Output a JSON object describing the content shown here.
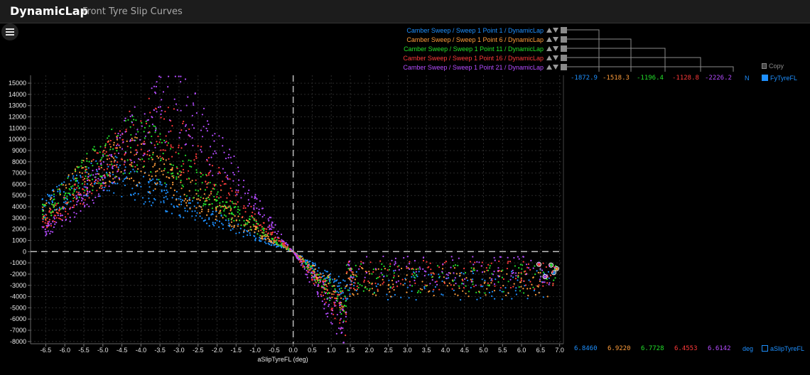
{
  "header": {
    "app": "DynamicLap",
    "page": "Front Tyre Slip Curves"
  },
  "toolbar": {
    "copy_label": "Copy"
  },
  "chart_data": {
    "type": "scatter",
    "xlabel": "aSlipTyreFL (deg)",
    "ylabel": "FyTyreFL",
    "xlim": [
      -6.9,
      7.1
    ],
    "ylim": [
      -8200,
      15700
    ],
    "xticks": [
      "-6.5",
      "-6.0",
      "-5.5",
      "-5.0",
      "-4.5",
      "-4.0",
      "-3.5",
      "-3.0",
      "-2.5",
      "-2.0",
      "-1.5",
      "-1.0",
      "-0.5",
      "0.0",
      "0.5",
      "1.0",
      "1.5",
      "2.0",
      "2.5",
      "3.0",
      "3.5",
      "4.0",
      "4.5",
      "5.0",
      "5.5",
      "6.0",
      "6.5",
      "7.0"
    ],
    "yticks": [
      "15000",
      "14000",
      "13000",
      "12000",
      "11000",
      "10000",
      "9000",
      "8000",
      "7000",
      "6000",
      "5000",
      "4000",
      "3000",
      "2000",
      "1000",
      "0",
      "-1000",
      "-2000",
      "-3000",
      "-4000",
      "-5000",
      "-6000",
      "-7000",
      "-8000"
    ],
    "grid": true,
    "series": [
      {
        "name": "Camber Sweep / Sweep 1 Point 1 / DynamicLap",
        "color": "#1e90ff",
        "y_readout": "-1872.9",
        "x_readout": "6.8460",
        "peak": 8100,
        "x_peak": -4.6,
        "tail": -3000
      },
      {
        "name": "Camber Sweep / Sweep 1 Point 6 / DynamicLap",
        "color": "#ff9d3b",
        "y_readout": "-1518.3",
        "x_readout": "6.9220",
        "peak": 9900,
        "x_peak": -4.2,
        "tail": -2700
      },
      {
        "name": "Camber Sweep / Sweep 1 Point 11 / DynamicLap",
        "color": "#22e02a",
        "y_readout": "-1196.4",
        "x_readout": "6.7728",
        "peak": 11500,
        "x_peak": -3.9,
        "tail": -2400
      },
      {
        "name": "Camber Sweep / Sweep 1 Point 16 / DynamicLap",
        "color": "#ff3a3a",
        "y_readout": "-1128.8",
        "x_readout": "6.4553",
        "peak": 13200,
        "x_peak": -3.4,
        "tail": -2100
      },
      {
        "name": "Camber Sweep / Sweep 1 Point 21 / DynamicLap",
        "color": "#b44cff",
        "y_readout": "-2226.2",
        "x_readout": "6.6142",
        "peak": 15600,
        "x_peak": -2.9,
        "tail": -1700
      }
    ],
    "y_unit": "N",
    "x_unit": "deg",
    "x_channel": "aSlipTyreFL",
    "y_channel": "FyTyreFL"
  },
  "colors": {
    "accent": "#1e90ff",
    "grid": "#2a2a2a",
    "zero_line": "#bdbdbd",
    "axis_text": "#e8e8e8"
  },
  "icons": {
    "menu": "hamburger-icon",
    "copy": "copy-icon",
    "move_up": "triangle-up-icon",
    "move_down": "triangle-down-icon",
    "toggle": "square-toggle-icon"
  }
}
